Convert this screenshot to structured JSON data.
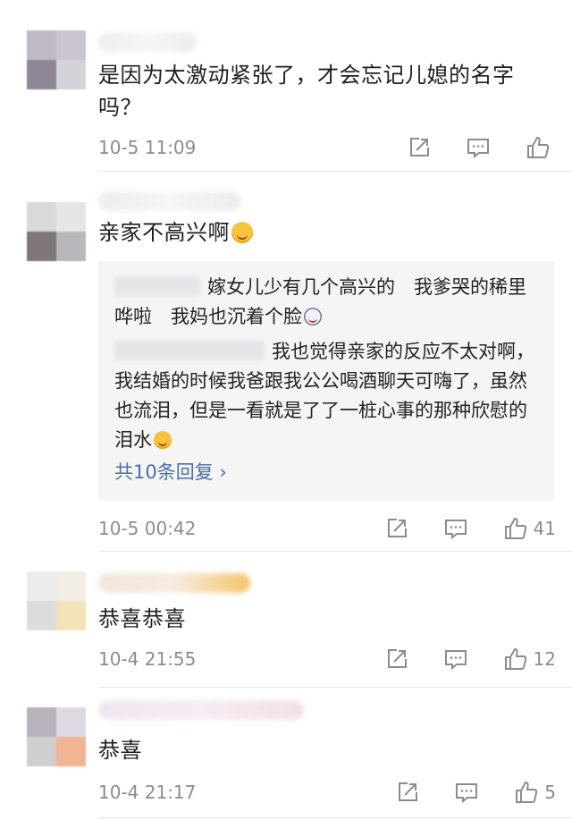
{
  "comments": [
    {
      "text": "是因为太激动紧张了，才会忘记儿媳的名字吗？",
      "time": "10-5 11:09",
      "like_count": ""
    },
    {
      "text": "亲家不高兴啊",
      "emoji": "grinning-sweat-emoji",
      "time": "10-5 00:42",
      "like_count": "41",
      "replies": [
        {
          "text": "嫁女儿少有几个高兴的　我爹哭的稀里哗啦　我妈也沉着个脸",
          "emoji": "scream-emoji"
        },
        {
          "text": "我也觉得亲家的反应不太对啊，我结婚的时候我爸跟我公公喝酒聊天可嗨了，虽然也流泪，但是一看就是了了一桩心事的那种欣慰的泪水",
          "emoji": "tears-of-joy-emoji"
        }
      ],
      "more_replies": "共10条回复 ›"
    },
    {
      "text": "恭喜恭喜",
      "time": "10-4 21:55",
      "like_count": "12"
    },
    {
      "text": "恭喜",
      "time": "10-4 21:17",
      "like_count": "5"
    }
  ],
  "icons": {
    "share": "share-icon",
    "comment": "comment-icon",
    "like": "like-icon"
  },
  "colors": {
    "meta_gray": "#8c8c8c",
    "link_blue": "#4a6fa8",
    "reply_bg": "#f5f5f5"
  }
}
